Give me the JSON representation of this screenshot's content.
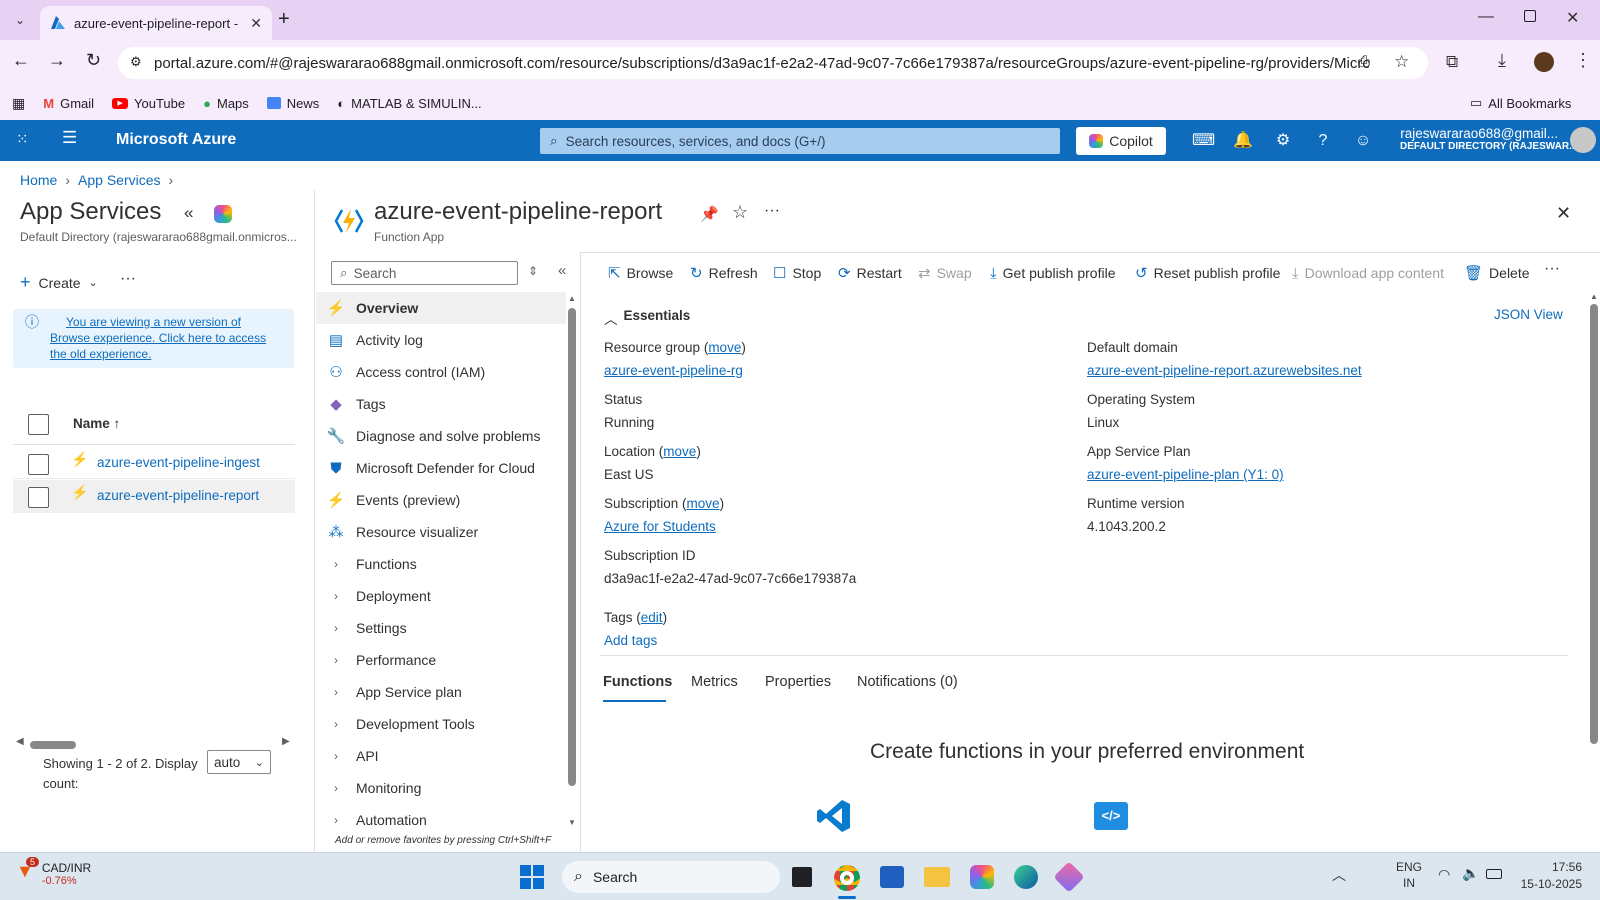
{
  "browser": {
    "tab_title": "azure-event-pipeline-report - M",
    "url": "portal.azure.com/#@rajeswararao688gmail.onmicrosoft.com/resource/subscriptions/d3a9ac1f-e2a2-47ad-9c07-7c66e179387a/resourceGroups/azure-event-pipeline-rg/providers/Microsoft.W...",
    "bookmarks": [
      "Gmail",
      "YouTube",
      "Maps",
      "News",
      "MATLAB & SIMULIN..."
    ],
    "all_bookmarks": "All Bookmarks"
  },
  "azure": {
    "brand": "Microsoft Azure",
    "search_placeholder": "Search resources, services, and docs (G+/)",
    "copilot": "Copilot",
    "user_name": "rajeswararao688@gmail...",
    "user_dir": "DEFAULT DIRECTORY (RAJESWAR..."
  },
  "breadcrumb": [
    "Home",
    "App Services"
  ],
  "left_blade": {
    "title": "App Services",
    "subtitle": "Default Directory (rajeswararao688gmail.onmicros...",
    "create": "Create",
    "info": "You are viewing a new version of Browse experience. Click here to access the old experience.",
    "col_name": "Name ↑",
    "rows": [
      "azure-event-pipeline-ingest",
      "azure-event-pipeline-report"
    ],
    "showing": "Showing 1 - 2 of 2. Display count:",
    "display_count": "auto"
  },
  "resource": {
    "title": "azure-event-pipeline-report",
    "type": "Function App",
    "search_placeholder": "Search"
  },
  "menu": [
    {
      "label": "Overview",
      "icon": "function-icon",
      "selected": true
    },
    {
      "label": "Activity log",
      "icon": "activity-log-icon"
    },
    {
      "label": "Access control (IAM)",
      "icon": "people-icon"
    },
    {
      "label": "Tags",
      "icon": "tag-icon"
    },
    {
      "label": "Diagnose and solve problems",
      "icon": "wrench-icon"
    },
    {
      "label": "Microsoft Defender for Cloud",
      "icon": "shield-icon"
    },
    {
      "label": "Events (preview)",
      "icon": "lightning-icon"
    },
    {
      "label": "Resource visualizer",
      "icon": "graph-icon"
    },
    {
      "label": "Functions",
      "expandable": true
    },
    {
      "label": "Deployment",
      "expandable": true
    },
    {
      "label": "Settings",
      "expandable": true
    },
    {
      "label": "Performance",
      "expandable": true
    },
    {
      "label": "App Service plan",
      "expandable": true
    },
    {
      "label": "Development Tools",
      "expandable": true
    },
    {
      "label": "API",
      "expandable": true
    },
    {
      "label": "Monitoring",
      "expandable": true
    },
    {
      "label": "Automation",
      "expandable": true
    }
  ],
  "menu_footer": "Add or remove favorites by pressing Ctrl+Shift+F",
  "toolbar": {
    "browse": "Browse",
    "refresh": "Refresh",
    "stop": "Stop",
    "restart": "Restart",
    "swap": "Swap",
    "get_publish": "Get publish profile",
    "reset_publish": "Reset publish profile",
    "download": "Download app content",
    "delete": "Delete"
  },
  "essentials": {
    "header": "Essentials",
    "json_view": "JSON View",
    "resource_group_label": "Resource group",
    "move": "move",
    "resource_group": "azure-event-pipeline-rg",
    "status_label": "Status",
    "status": "Running",
    "location_label": "Location",
    "location": "East US",
    "subscription_label": "Subscription",
    "subscription": "Azure for Students",
    "subscription_id_label": "Subscription ID",
    "subscription_id": "d3a9ac1f-e2a2-47ad-9c07-7c66e179387a",
    "default_domain_label": "Default domain",
    "default_domain": "azure-event-pipeline-report.azurewebsites.net",
    "os_label": "Operating System",
    "os": "Linux",
    "plan_label": "App Service Plan",
    "plan": "azure-event-pipeline-plan (Y1: 0)",
    "runtime_label": "Runtime version",
    "runtime": "4.1043.200.2",
    "tags_label": "Tags",
    "edit": "edit",
    "add_tags": "Add tags"
  },
  "tabs": [
    "Functions",
    "Metrics",
    "Properties",
    "Notifications (0)"
  ],
  "create_heading": "Create functions in your preferred environment",
  "taskbar": {
    "ticker": "CAD/INR",
    "ticker_change": "-0.76%",
    "badge": "5",
    "search": "Search",
    "lang1": "ENG",
    "lang2": "IN",
    "time": "17:56",
    "date": "15-10-2025"
  }
}
